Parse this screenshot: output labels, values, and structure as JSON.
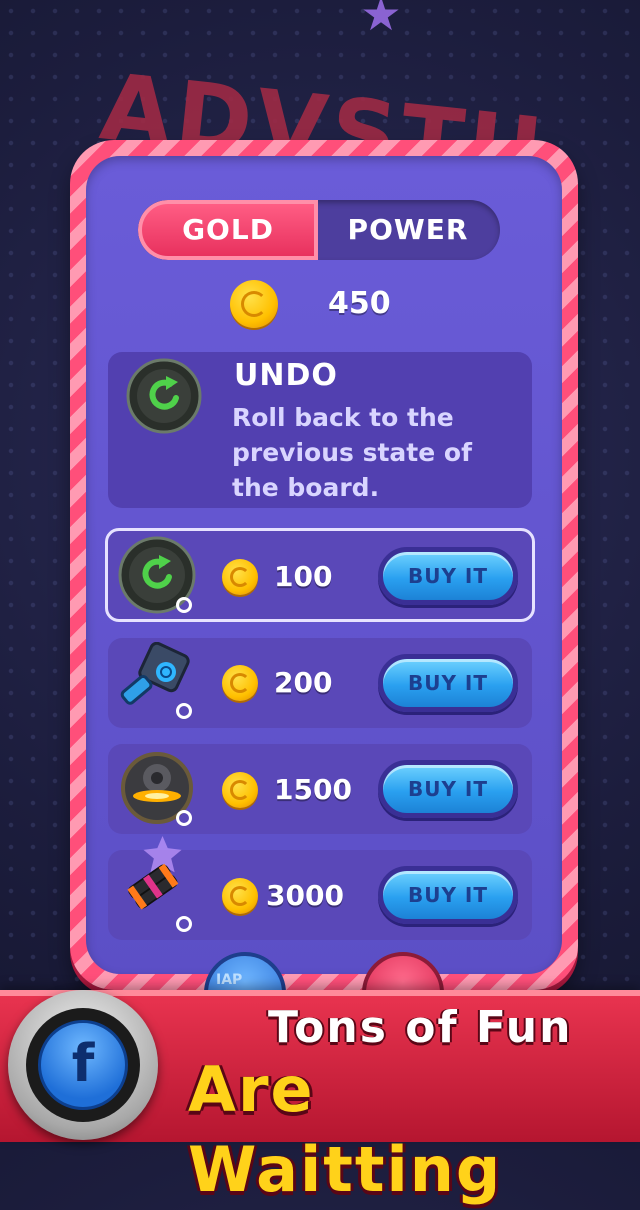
{
  "background": {
    "title_text": "ADVSTU"
  },
  "tabs": {
    "gold_label": "GOLD",
    "power_label": "POWER",
    "active": "GOLD"
  },
  "balance": {
    "value": "450",
    "icon": "gold-coin-icon"
  },
  "item_info": {
    "title": "UNDO",
    "description": "Roll back to the previous state of the board.",
    "icon": "undo-icon"
  },
  "items": [
    {
      "icon": "undo-icon",
      "quantity": "0",
      "price": "100",
      "buy_label": "BUY IT",
      "selected": true
    },
    {
      "icon": "hammer-icon",
      "quantity": "0",
      "price": "200",
      "buy_label": "BUY IT",
      "selected": false
    },
    {
      "icon": "bomb-icon",
      "quantity": "0",
      "price": "1500",
      "buy_label": "BUY IT",
      "selected": false
    },
    {
      "icon": "dynamite-icon",
      "quantity": "0",
      "price": "3000",
      "buy_label": "BUY IT",
      "selected": false
    }
  ],
  "bottom_buttons": {
    "iap_label": "IAP"
  },
  "banner": {
    "line1": "Tons of Fun",
    "line2": "Are Waitting",
    "facebook_letter": "f"
  },
  "colors": {
    "tab_active": "#ff5d84",
    "panel": "#6a5cd8",
    "buy_button": "#2aa0f0",
    "banner_red": "#e8334f",
    "banner_yellow": "#ffd21a"
  }
}
